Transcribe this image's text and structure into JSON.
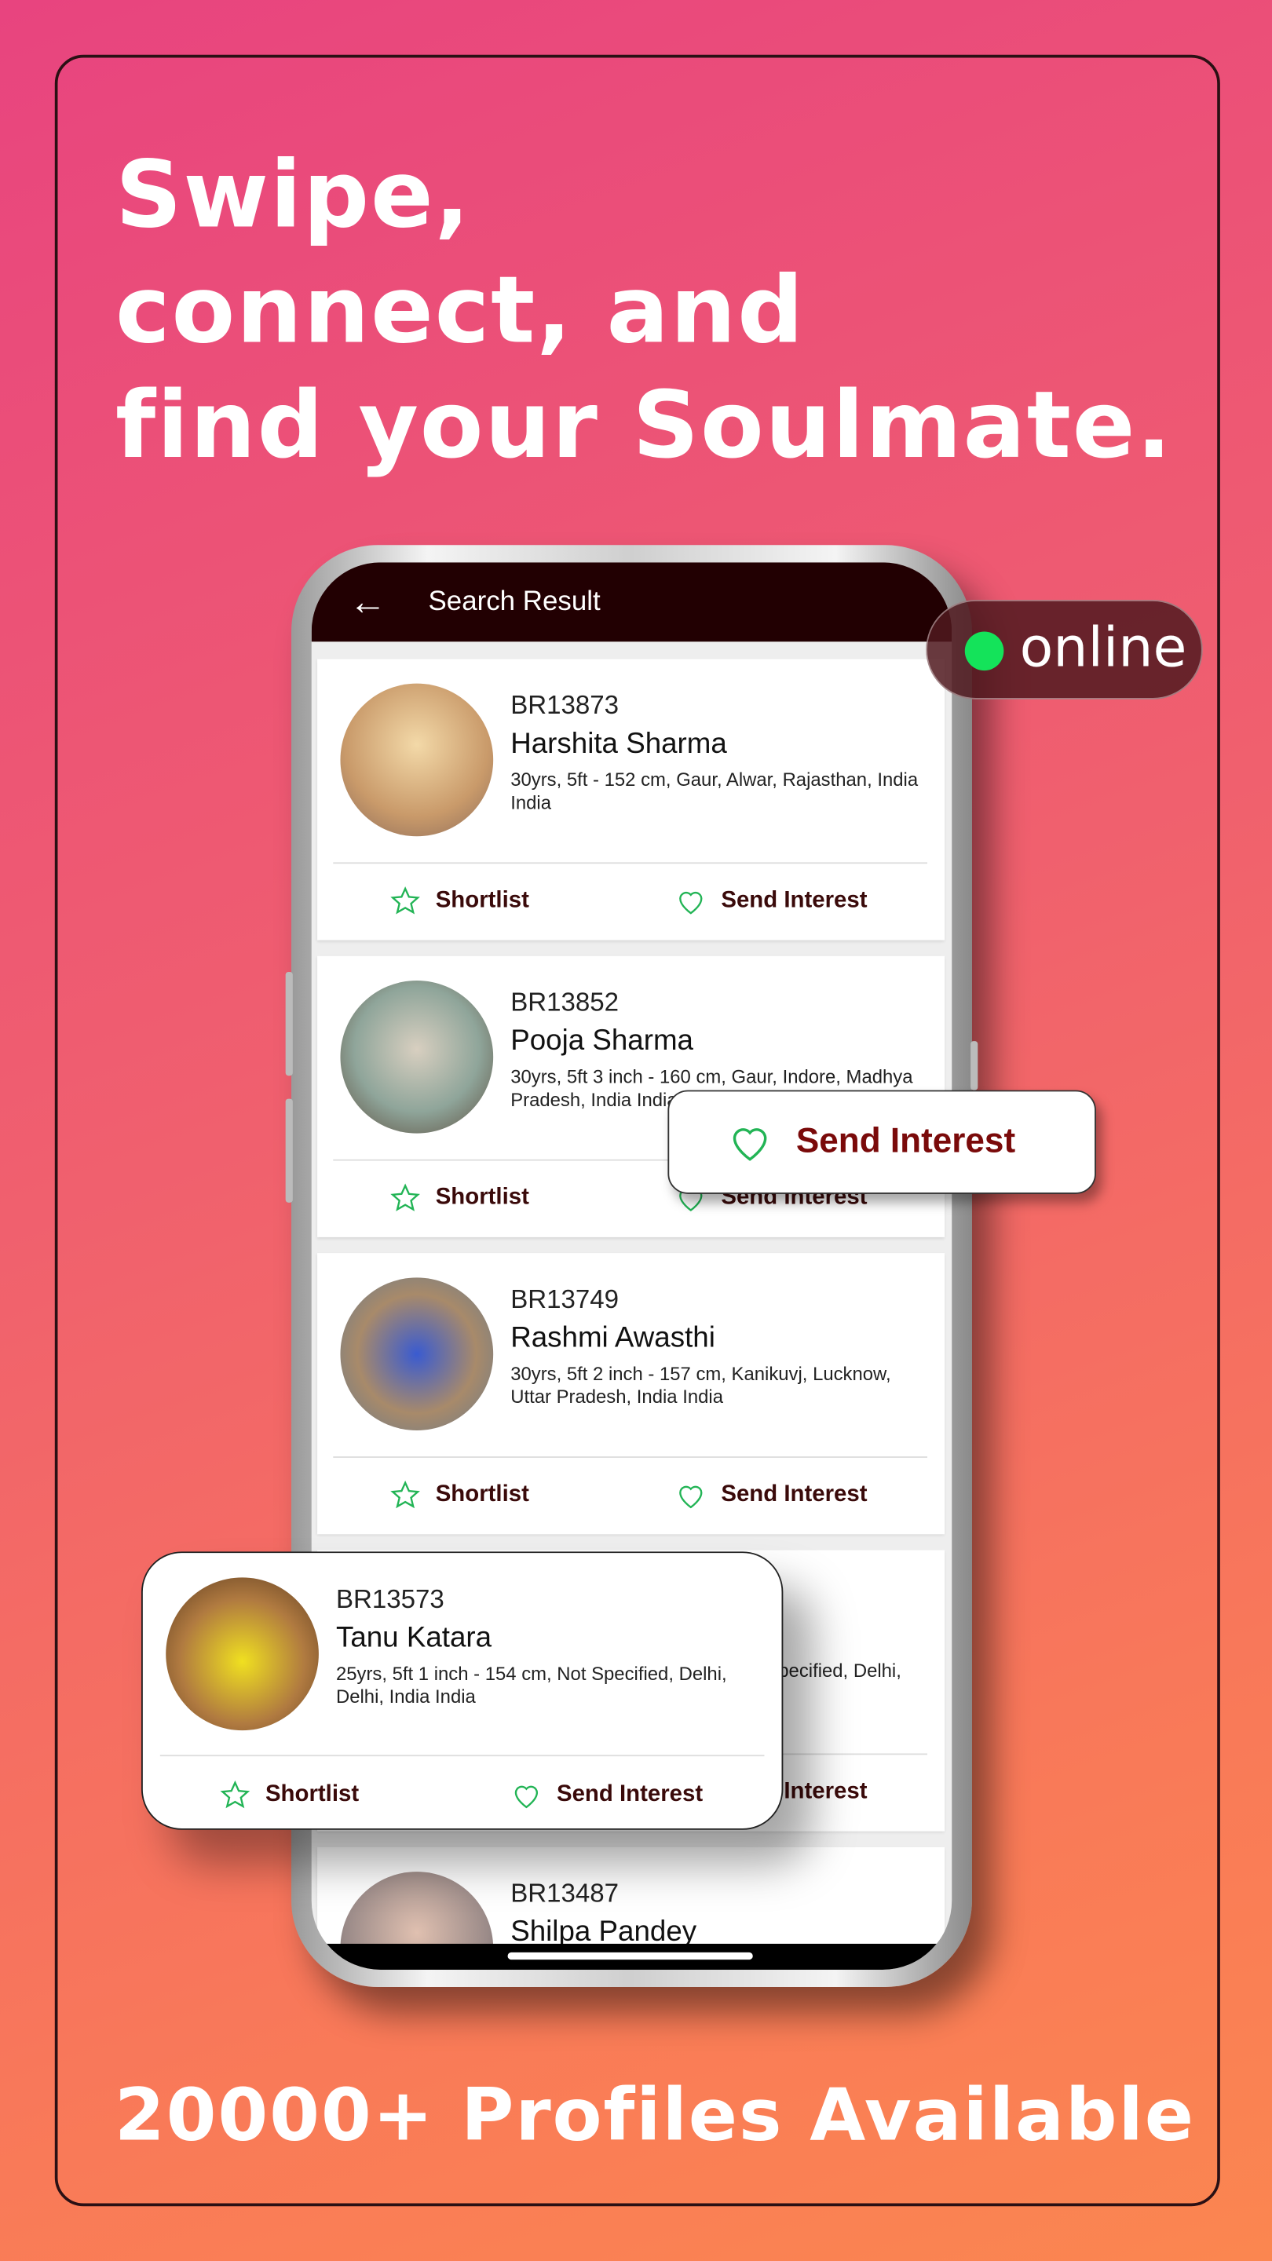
{
  "headline": [
    "Swipe,",
    "connect, and",
    "find your Soulmate."
  ],
  "footer": "20000+ Profiles Available",
  "online_badge": {
    "label": "online",
    "dot_color": "#14e35a"
  },
  "app": {
    "title": "Search Result",
    "back_icon": "arrow-left-icon"
  },
  "actions": {
    "shortlist": "Shortlist",
    "send_interest": "Send Interest",
    "shortlist_icon": "star-outline-icon",
    "interest_icon": "heart-outline-icon",
    "icon_color": "#22b455"
  },
  "send_interest_popup": {
    "label": "Send Interest"
  },
  "profiles": [
    {
      "id": "BR13873",
      "name": "Harshita Sharma",
      "details": "30yrs, 5ft - 152 cm, Gaur, Alwar, Rajasthan, India India"
    },
    {
      "id": "BR13852",
      "name": "Pooja Sharma",
      "details": "30yrs, 5ft 3 inch - 160 cm, Gaur, Indore, Madhya Pradesh, India India"
    },
    {
      "id": "BR13749",
      "name": "Rashmi Awasthi",
      "details": "30yrs, 5ft 2 inch - 157 cm, Kanikuvj, Lucknow, Uttar Pradesh, India India"
    },
    {
      "id": "BR13573",
      "name": "Tanu Katara",
      "details": "25yrs, 5ft 1 inch - 154 cm, Not Specified, Delhi, Delhi, India India"
    },
    {
      "id": "BR13487",
      "name": "Shilpa Pandey",
      "details": ""
    }
  ],
  "colors": {
    "accent": "#220002",
    "bg_start": "#e8447f",
    "bg_end": "#fb8650",
    "action_text": "#3a0a0a"
  }
}
